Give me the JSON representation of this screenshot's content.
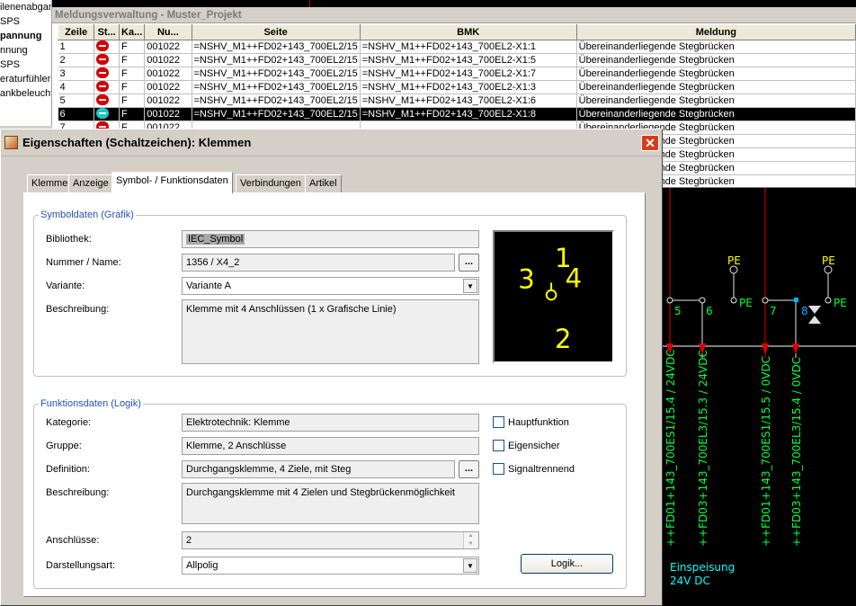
{
  "left_strip": {
    "items": [
      "ilenenabgang",
      "SPS",
      "pannung",
      "nnung",
      "SPS",
      "eraturfühler",
      "ankbeleucht"
    ]
  },
  "message_window": {
    "title": "Meldungsverwaltung - Muster_Projekt",
    "columns": [
      "Zeile",
      "St...",
      "Ka...",
      "Nu...",
      "Seite",
      "BMK",
      "Meldung"
    ],
    "rows": [
      {
        "zeile": "1",
        "ka": "F",
        "nu": "001022",
        "seite": "=NSHV_M1++FD02+143_700EL2/15",
        "bmk": "=NSHV_M1++FD02+143_700EL2-X1:1",
        "meldung": "Übereinanderliegende Stegbrücken"
      },
      {
        "zeile": "2",
        "ka": "F",
        "nu": "001022",
        "seite": "=NSHV_M1++FD02+143_700EL2/15",
        "bmk": "=NSHV_M1++FD02+143_700EL2-X1:5",
        "meldung": "Übereinanderliegende Stegbrücken"
      },
      {
        "zeile": "3",
        "ka": "F",
        "nu": "001022",
        "seite": "=NSHV_M1++FD02+143_700EL2/15",
        "bmk": "=NSHV_M1++FD02+143_700EL2-X1:7",
        "meldung": "Übereinanderliegende Stegbrücken"
      },
      {
        "zeile": "4",
        "ka": "F",
        "nu": "001022",
        "seite": "=NSHV_M1++FD02+143_700EL2/15",
        "bmk": "=NSHV_M1++FD02+143_700EL2-X1:3",
        "meldung": "Übereinanderliegende Stegbrücken"
      },
      {
        "zeile": "5",
        "ka": "F",
        "nu": "001022",
        "seite": "=NSHV_M1++FD02+143_700EL2/15",
        "bmk": "=NSHV_M1++FD02+143_700EL2-X1:6",
        "meldung": "Übereinanderliegende Stegbrücken"
      },
      {
        "zeile": "6",
        "ka": "F",
        "nu": "001022",
        "seite": "=NSHV_M1++FD02+143_700EL2/15",
        "bmk": "=NSHV_M1++FD02+143_700EL2-X1:8",
        "meldung": "Übereinanderliegende Stegbrücken",
        "selected": true
      },
      {
        "zeile": "7",
        "ka": "F",
        "nu": "001022",
        "seite": "",
        "bmk": "",
        "meldung": "Übereinanderliegende Stegbrücken"
      },
      {
        "zeile": "",
        "ka": "",
        "nu": "",
        "seite": "",
        "bmk": "",
        "meldung": "Übereinanderliegende Stegbrücken"
      },
      {
        "zeile": "",
        "ka": "",
        "nu": "",
        "seite": "",
        "bmk": "",
        "meldung": "Übereinanderliegende Stegbrücken"
      },
      {
        "zeile": "",
        "ka": "",
        "nu": "",
        "seite": "",
        "bmk": "",
        "meldung": "Übereinanderliegende Stegbrücken"
      },
      {
        "zeile": "",
        "ka": "",
        "nu": "",
        "seite": "",
        "bmk": "",
        "meldung": "Übereinanderliegende Stegbrücken"
      }
    ]
  },
  "dialog": {
    "title": "Eigenschaften (Schaltzeichen): Klemmen",
    "close": "✕",
    "tabs": [
      "Klemme",
      "Anzeige",
      "Symbol- / Funktionsdaten",
      "Verbindungen",
      "Artikel"
    ],
    "symbol_group": {
      "legend": "Symboldaten (Grafik)",
      "bibliothek_label": "Bibliothek:",
      "bibliothek": "IEC_Symbol",
      "nummer_label": "Nummer / Name:",
      "nummer": "1356 / X4_2",
      "variante_label": "Variante:",
      "variante": "Variante A",
      "beschreibung_label": "Beschreibung:",
      "beschreibung": "Klemme mit 4 Anschlüssen (1 x Grafische Linie)",
      "preview_labels": [
        "1",
        "2",
        "3",
        "4"
      ]
    },
    "function_group": {
      "legend": "Funktionsdaten (Logik)",
      "kategorie_label": "Kategorie:",
      "kategorie": "Elektrotechnik: Klemme",
      "gruppe_label": "Gruppe:",
      "gruppe": "Klemme, 2 Anschlüsse",
      "definition_label": "Definition:",
      "definition": "Durchgangsklemme, 4 Ziele, mit Steg",
      "beschreibung_label": "Beschreibung:",
      "beschreibung": "Durchgangsklemme mit 4 Zielen und Stegbrückenmöglichkeit",
      "anschluesse_label": "Anschlüsse:",
      "anschluesse": "2",
      "darstellung_label": "Darstellungsart:",
      "darstellung": "Allpolig",
      "hauptfunktion": "Hauptfunktion",
      "eigensicher": "Eigensicher",
      "signaltrennend": "Signaltrennend",
      "logik_button": "Logik..."
    },
    "browse_button": "..."
  },
  "schematic": {
    "terminals": [
      "5",
      "6",
      "7",
      "8"
    ],
    "pe_labels": [
      "PE",
      "PE",
      "PE",
      "PE"
    ],
    "wire_labels": [
      "++FD01+143_700ES1/15.4 / 24VDC",
      "++FD03+143_700EL3/15.3 / 24VDC",
      "++FD01+143_700ES1/15.5 / 0VDC",
      "++FD03+143_700EL3/15.4 / 0VDC"
    ],
    "caption_line1": "Einspeisung",
    "caption_line2": "24V DC"
  },
  "colors": {
    "schematic_green": "#00ff3c",
    "schematic_red": "#e00000",
    "preview_yellow": "#ffff00",
    "legend_blue": "#2453b4",
    "selection": "#000000"
  }
}
